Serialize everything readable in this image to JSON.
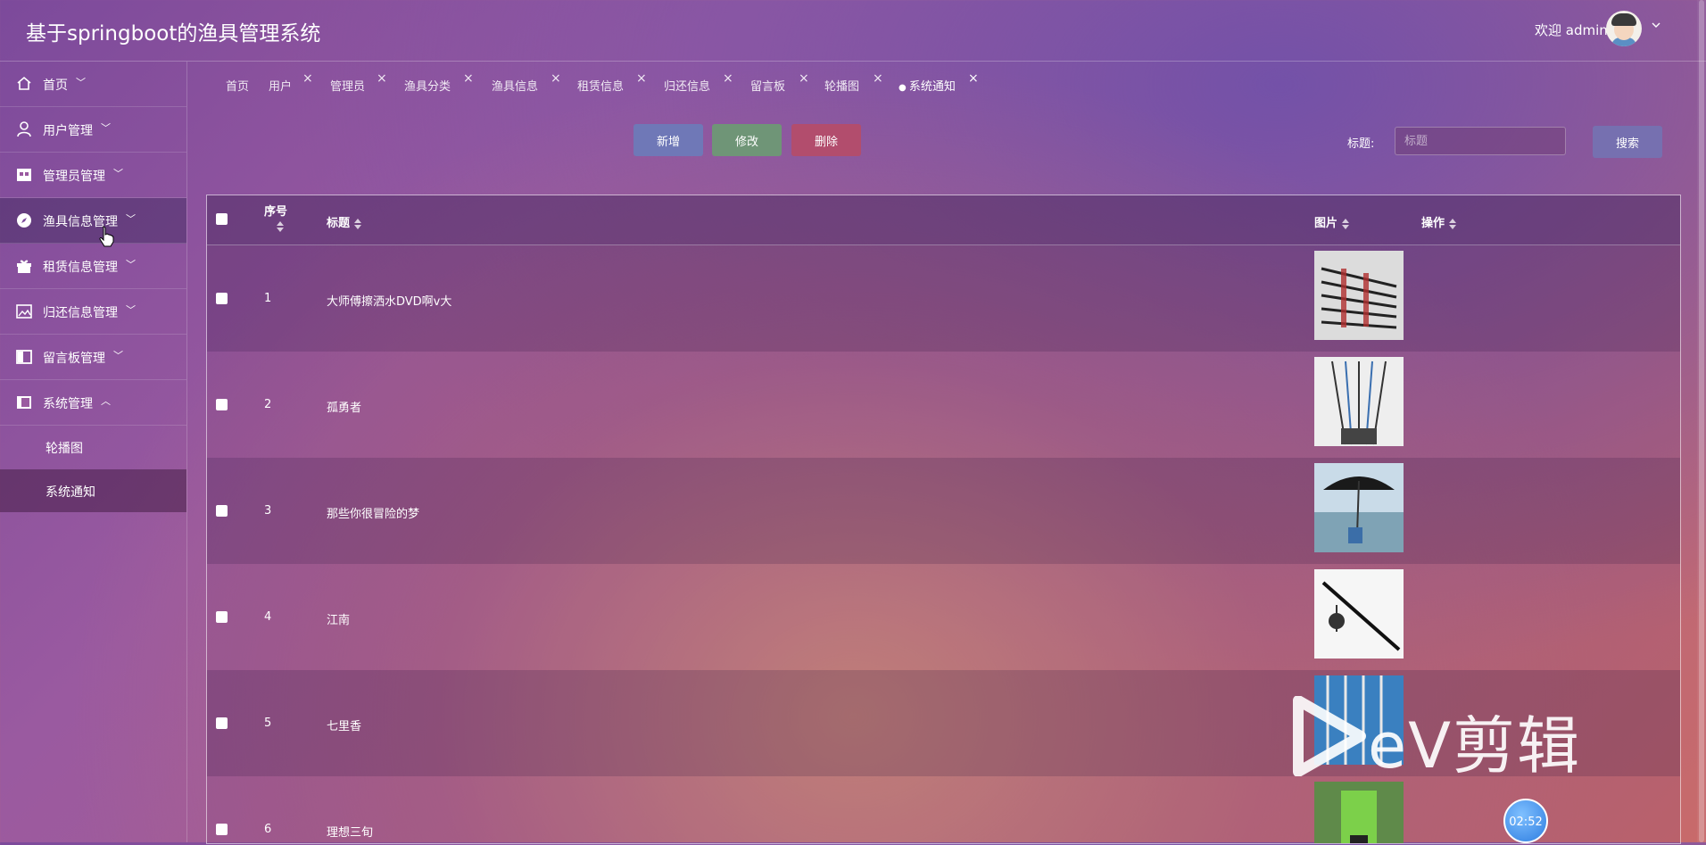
{
  "app": {
    "title": "基于springboot的渔具管理系统",
    "welcome": "欢迎 admin"
  },
  "sidebar": {
    "items": [
      {
        "label": "首页",
        "icon": "home-icon"
      },
      {
        "label": "用户管理",
        "icon": "user-icon"
      },
      {
        "label": "管理员管理",
        "icon": "store-icon"
      },
      {
        "label": "渔具信息管理",
        "icon": "compass-icon"
      },
      {
        "label": "租赁信息管理",
        "icon": "gift-icon"
      },
      {
        "label": "归还信息管理",
        "icon": "picture-icon"
      },
      {
        "label": "留言板管理",
        "icon": "panel-icon"
      },
      {
        "label": "系统管理",
        "icon": "layout-icon"
      }
    ],
    "sub_items": [
      {
        "label": "轮播图"
      },
      {
        "label": "系统通知"
      }
    ]
  },
  "tabs": [
    {
      "label": "首页"
    },
    {
      "label": "用户"
    },
    {
      "label": "管理员"
    },
    {
      "label": "渔具分类"
    },
    {
      "label": "渔具信息"
    },
    {
      "label": "租赁信息"
    },
    {
      "label": "归还信息"
    },
    {
      "label": "留言板"
    },
    {
      "label": "轮播图"
    },
    {
      "label": "系统通知",
      "active": true
    }
  ],
  "toolbar": {
    "add_label": "新增",
    "edit_label": "修改",
    "delete_label": "删除",
    "search_label": "标题:",
    "search_placeholder": "标题",
    "search_button": "搜索"
  },
  "table": {
    "columns": {
      "index": "序号",
      "title": "标题",
      "image": "图片",
      "actions": "操作"
    },
    "rows": [
      {
        "num": "1",
        "title": "大师傅擦洒水DVD啊v大",
        "image": "fishing-rods-dark"
      },
      {
        "num": "2",
        "title": "孤勇者",
        "image": "fishing-rods-light"
      },
      {
        "num": "3",
        "title": "那些你很冒险的梦",
        "image": "umbrella-lake"
      },
      {
        "num": "4",
        "title": "江南",
        "image": "spinning-rod"
      },
      {
        "num": "5",
        "title": "七里香",
        "image": "rods-blue"
      },
      {
        "num": "6",
        "title": "理想三旬",
        "image": "angler-green"
      }
    ]
  },
  "watermark": {
    "text": "eV剪辑",
    "timer": "02:52"
  },
  "colors": {
    "add": "#6f78b7",
    "edit": "#6f9577",
    "delete": "#b24d6d",
    "search": "#7670b0"
  }
}
